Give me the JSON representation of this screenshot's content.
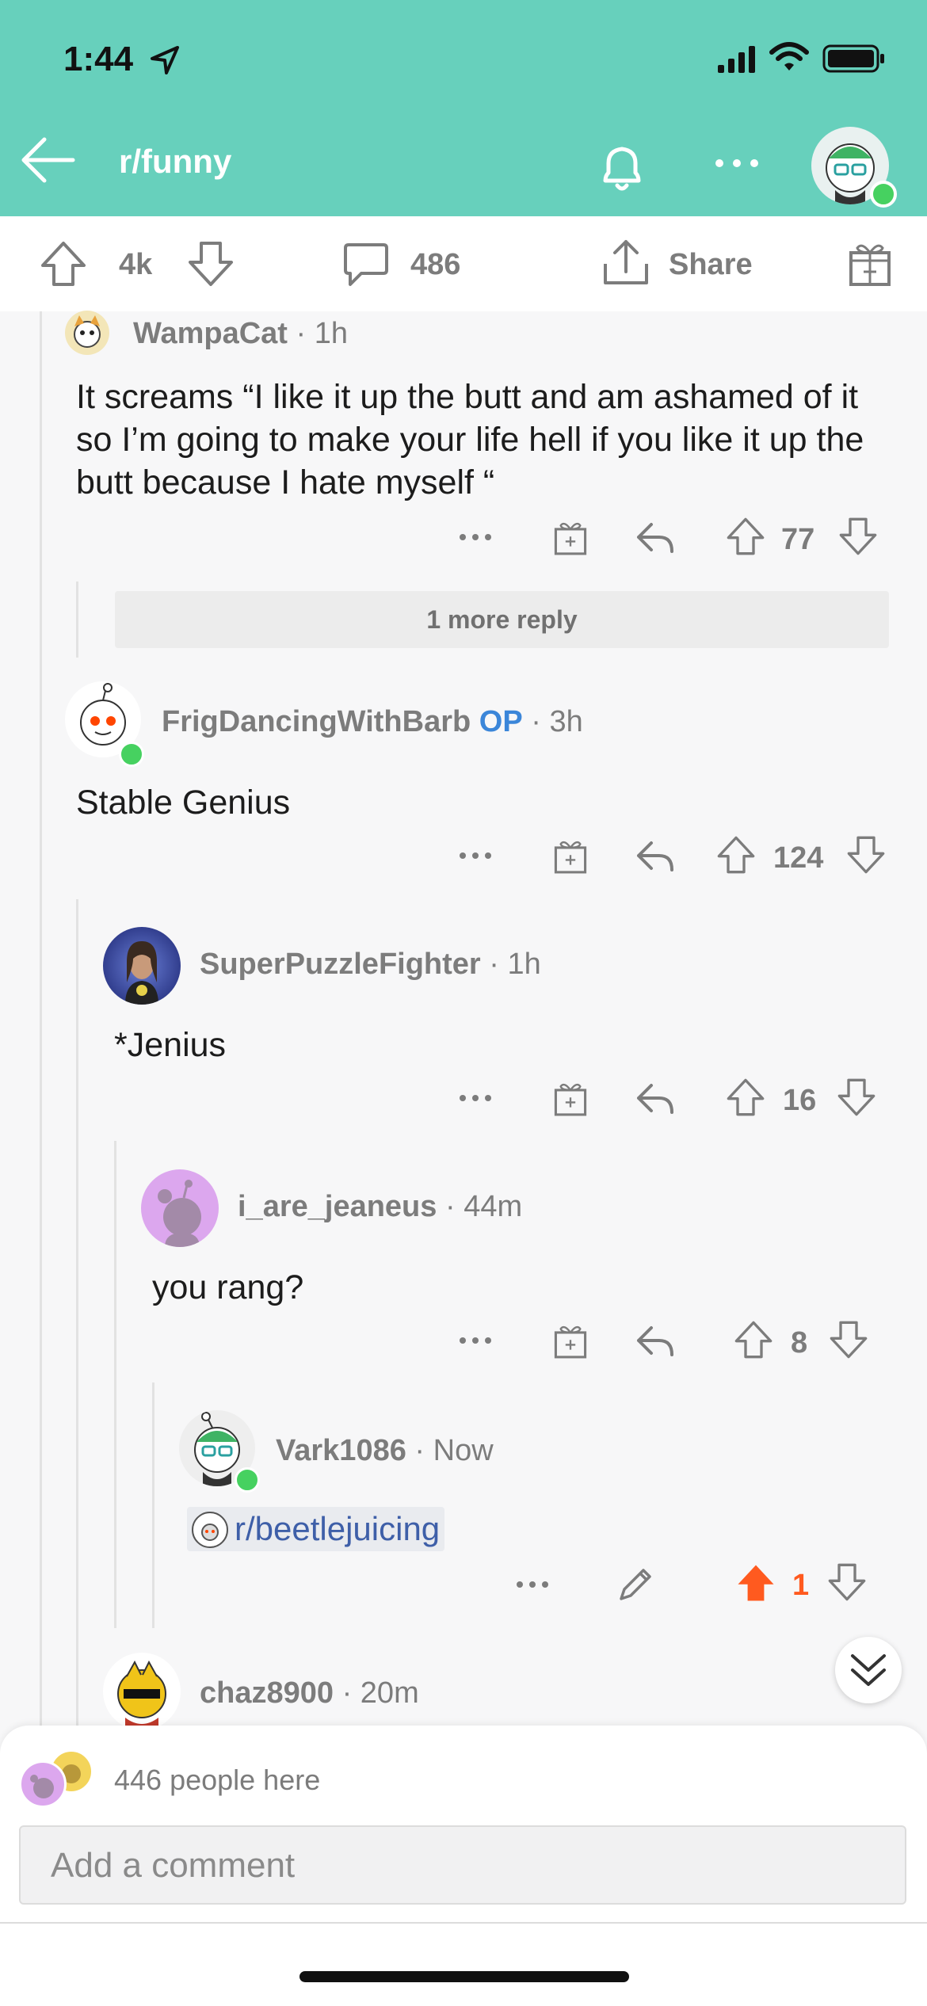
{
  "status_bar": {
    "time": "1:44"
  },
  "nav": {
    "title": "r/funny"
  },
  "post_actions": {
    "score": "4k",
    "comment_count": "486",
    "share_label": "Share"
  },
  "comments": [
    {
      "user": "WampaCat",
      "meta": "1h",
      "body": "It screams “I like it up the butt and am ashamed of it so I’m going to make your life hell if you like it up the butt because I hate myself “",
      "score": "77"
    },
    {
      "more_replies": "1 more reply"
    },
    {
      "user": "FrigDancingWithBarb",
      "op_badge": "OP",
      "meta": "3h",
      "body": "Stable Genius",
      "score": "124"
    },
    {
      "user": "SuperPuzzleFighter",
      "meta": "1h",
      "body": "*Jenius",
      "score": "16"
    },
    {
      "user": "i_are_jeaneus",
      "meta": "44m",
      "body": "you rang?",
      "score": "8"
    },
    {
      "user": "Vark1086",
      "meta": "Now",
      "body": "r/beetlejuicing",
      "score": "1",
      "upvoted": true
    },
    {
      "user": "chaz8900",
      "meta": "20m"
    }
  ],
  "colors": {
    "header": "#67d0bc",
    "op": "#3b86d9",
    "upvote": "#ff5a1f",
    "link": "#3e5fa8"
  },
  "presence": {
    "text": "446 people here"
  },
  "composer": {
    "placeholder": "Add a comment"
  }
}
